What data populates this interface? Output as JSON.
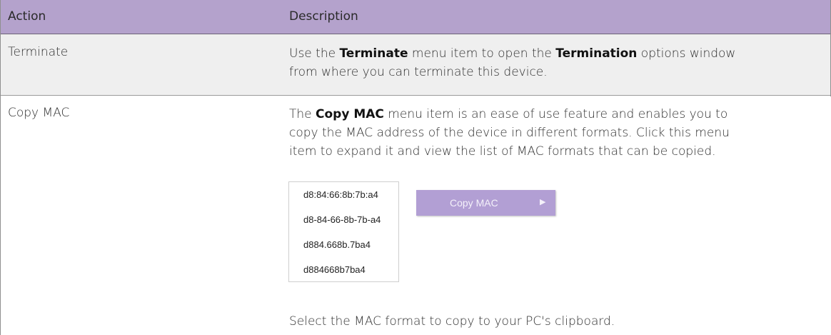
{
  "header": {
    "col_action": "Action",
    "col_description": "Description"
  },
  "rows": [
    {
      "action": "Terminate",
      "description": {
        "p1_a": "Use the ",
        "p1_bold1": "Terminate",
        "p1_b": " menu item to open the ",
        "p1_bold2": "Termination",
        "p1_c": " options window",
        "line2": "from where you can terminate this device."
      }
    },
    {
      "action": "Copy MAC",
      "description": {
        "l1_a": "The ",
        "l1_bold": "Copy MAC",
        "l1_b": " menu item is an ease of use feature and enables you to",
        "line2": "copy the MAC address of the device in different formats. Click this menu",
        "line3": "item to expand it and view the list of MAC formats that can be copied.",
        "footer": "Select the MAC format to copy to your PC's clipboard."
      },
      "mac_menu": {
        "formats": [
          "d8:84:66:8b:7b:a4",
          "d8-84-66-8b-7b-a4",
          "d884.668b.7ba4",
          "d884668b7ba4"
        ],
        "submenu_label": "Copy MAC",
        "submenu_arrow_icon": "triangle-right-icon"
      }
    }
  ]
}
